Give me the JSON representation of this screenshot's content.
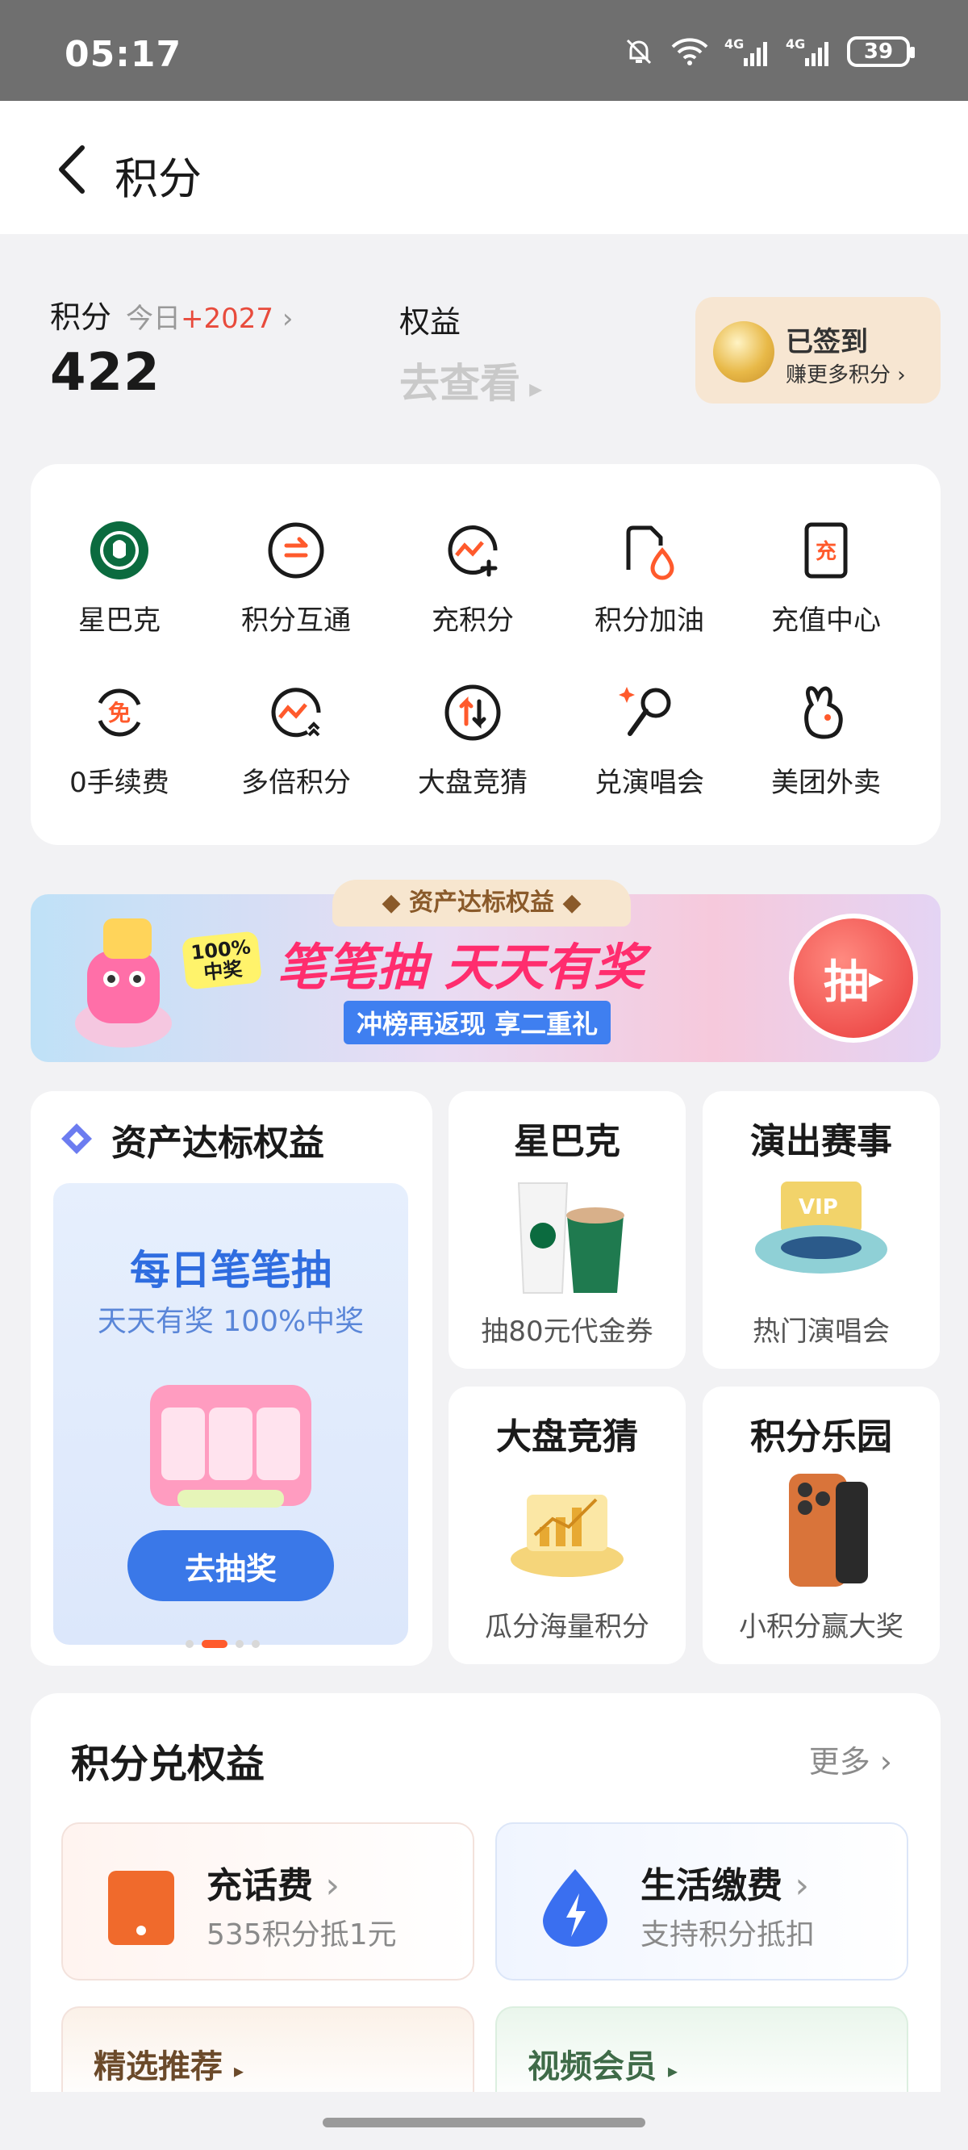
{
  "status_bar": {
    "time": "05:17",
    "battery": "39"
  },
  "nav": {
    "title": "积分"
  },
  "summary": {
    "points_label": "积分",
    "today_label": "今日",
    "today_delta": "+2027",
    "points_value": "422",
    "rights_label": "权益",
    "rights_link": "去查看",
    "signin_title": "已签到",
    "signin_sub": "赚更多积分"
  },
  "grid": [
    {
      "label": "星巴克",
      "icon": "starbucks-icon"
    },
    {
      "label": "积分互通",
      "icon": "exchange-icon"
    },
    {
      "label": "充积分",
      "icon": "add-points-icon"
    },
    {
      "label": "积分加油",
      "icon": "fuel-icon"
    },
    {
      "label": "充值中心",
      "icon": "recharge-icon"
    },
    {
      "label": "0手续费",
      "icon": "free-fee-icon"
    },
    {
      "label": "多倍积分",
      "icon": "multiple-points-icon"
    },
    {
      "label": "大盘竞猜",
      "icon": "market-guess-icon"
    },
    {
      "label": "兑演唱会",
      "icon": "concert-icon"
    },
    {
      "label": "美团外卖",
      "icon": "meituan-icon"
    }
  ],
  "banner": {
    "tag": "资产达标权益",
    "headline": "笔笔抽 天天有奖",
    "sub": "冲榜再返现 享二重礼",
    "badge": "100%\n中奖",
    "button": "抽"
  },
  "asset": {
    "title": "资产达标权益",
    "big": "每日笔笔抽",
    "small": "天天有奖 100%中奖",
    "button": "去抽奖"
  },
  "minis": [
    {
      "title": "星巴克",
      "sub": "抽80元代金券"
    },
    {
      "title": "演出赛事",
      "sub": "热门演唱会"
    },
    {
      "title": "大盘竞猜",
      "sub": "瓜分海量积分"
    },
    {
      "title": "积分乐园",
      "sub": "小积分赢大奖"
    }
  ],
  "exchange": {
    "title": "积分兑权益",
    "more": "更多",
    "items": [
      {
        "title": "充话费",
        "sub": "535积分抵1元"
      },
      {
        "title": "生活缴费",
        "sub": "支持积分抵扣"
      }
    ],
    "tabs": [
      "精选推荐",
      "视频会员"
    ]
  },
  "colors": {
    "accent_red": "#e84b3c",
    "blue": "#3a78e8",
    "orange": "#ff5a2c"
  }
}
